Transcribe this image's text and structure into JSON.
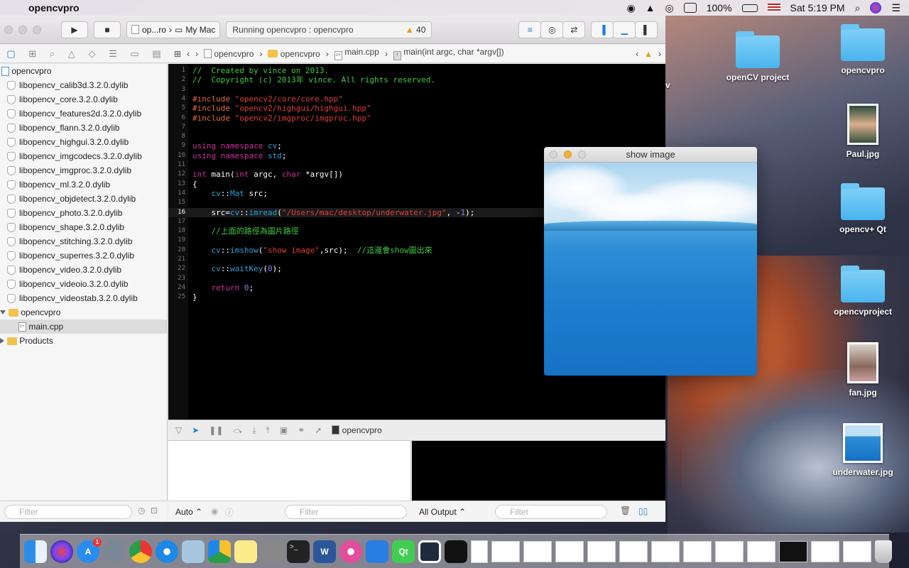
{
  "menubar": {
    "app_name": "opencvpro",
    "battery": "100%",
    "clock": "Sat 5:19 PM"
  },
  "toolbar": {
    "scheme_target": "op...ro",
    "scheme_device": "My Mac",
    "status_text": "Running opencvpro : opencvpro",
    "warning_count": "40"
  },
  "jumpbar": {
    "crumbs": [
      "opencvpro",
      "opencvpro",
      "main.cpp",
      "main(int argc, char *argv[])"
    ]
  },
  "navigator": {
    "project": "opencvpro",
    "libs": [
      "libopencv_calib3d.3.2.0.dylib",
      "libopencv_core.3.2.0.dylib",
      "libopencv_features2d.3.2.0.dylib",
      "libopencv_flann.3.2.0.dylib",
      "libopencv_highgui.3.2.0.dylib",
      "libopencv_imgcodecs.3.2.0.dylib",
      "libopencv_imgproc.3.2.0.dylib",
      "libopencv_ml.3.2.0.dylib",
      "libopencv_objdetect.3.2.0.dylib",
      "libopencv_photo.3.2.0.dylib",
      "libopencv_shape.3.2.0.dylib",
      "libopencv_stitching.3.2.0.dylib",
      "libopencv_superres.3.2.0.dylib",
      "libopencv_video.3.2.0.dylib",
      "libopencv_videoio.3.2.0.dylib",
      "libopencv_videostab.3.2.0.dylib"
    ],
    "group": "opencvpro",
    "file": "main.cpp",
    "products": "Products",
    "filter_placeholder": "Filter"
  },
  "editor": {
    "line_numbers": [
      "1",
      "2",
      "3",
      "4",
      "5",
      "6",
      "7",
      "8",
      "9",
      "10",
      "11",
      "12",
      "13",
      "14",
      "15",
      "16",
      "17",
      "18",
      "19",
      "20",
      "21",
      "22",
      "23",
      "24",
      "25"
    ],
    "l1": "//  Created by vince on 2013.",
    "l2": "//  Copyright (c) 2013年 vince. All rights reserved.",
    "l4a": "#include ",
    "l4b": "\"opencv2/core/core.hpp\"",
    "l5a": "#include ",
    "l5b": "\"opencv2/highgui/highgui.hpp\"",
    "l6a": "#include ",
    "l6b": "\"opencv2/imgproc/imgproc.hpp\"",
    "l9a": "using namespace ",
    "l9b": "cv",
    "l9c": ";",
    "l10a": "using namespace ",
    "l10b": "std",
    "l10c": ";",
    "l12a": "int",
    "l12b": " main(",
    "l12c": "int",
    "l12d": " argc, ",
    "l12e": "char",
    "l12f": " *argv[])",
    "l13": "{",
    "l14a": "    ",
    "l14b": "cv",
    "l14c": "::",
    "l14d": "Mat",
    "l14e": " src;",
    "l16a": "    src=",
    "l16b": "cv",
    "l16c": "::",
    "l16d": "imread",
    "l16e": "(",
    "l16f": "\"/Users/mac/desktop/underwater.jpg\"",
    "l16g": ", -",
    "l16h": "1",
    "l16i": ");",
    "l18": "    //上面的路徑為圖片路徑",
    "l20a": "    ",
    "l20b": "cv",
    "l20c": "::",
    "l20d": "imshow",
    "l20e": "(",
    "l20f": "\"show image\"",
    "l20g": ",src);  ",
    "l20h": "//這邊會show圖出來",
    "l22a": "    ",
    "l22b": "cv",
    "l22c": "::",
    "l22d": "waitKey",
    "l22e": "(",
    "l22f": "0",
    "l22g": ");",
    "l24a": "    ",
    "l24b": "return",
    "l24c": " ",
    "l24d": "0",
    "l24e": ";",
    "l25": "}"
  },
  "debug": {
    "process": "opencvpro",
    "auto_label": "Auto ⌃",
    "output_label": "All Output ⌃",
    "filter_placeholder": "Filter"
  },
  "image_window": {
    "title": "show image"
  },
  "desktop": {
    "icons": [
      "opencvpro",
      "openCV project",
      "Paul.jpg",
      "opencv+ Qt",
      "opencvproject",
      "fan.jpg",
      "underwater.jpg"
    ],
    "partial_label": "v"
  },
  "dock": {
    "appstore_badge": "1"
  },
  "colors": {
    "comment": "#41cc45",
    "keyword": "#d0309f",
    "string": "#e33b3b",
    "type": "#2aa2d8",
    "number": "#8a7cff"
  }
}
